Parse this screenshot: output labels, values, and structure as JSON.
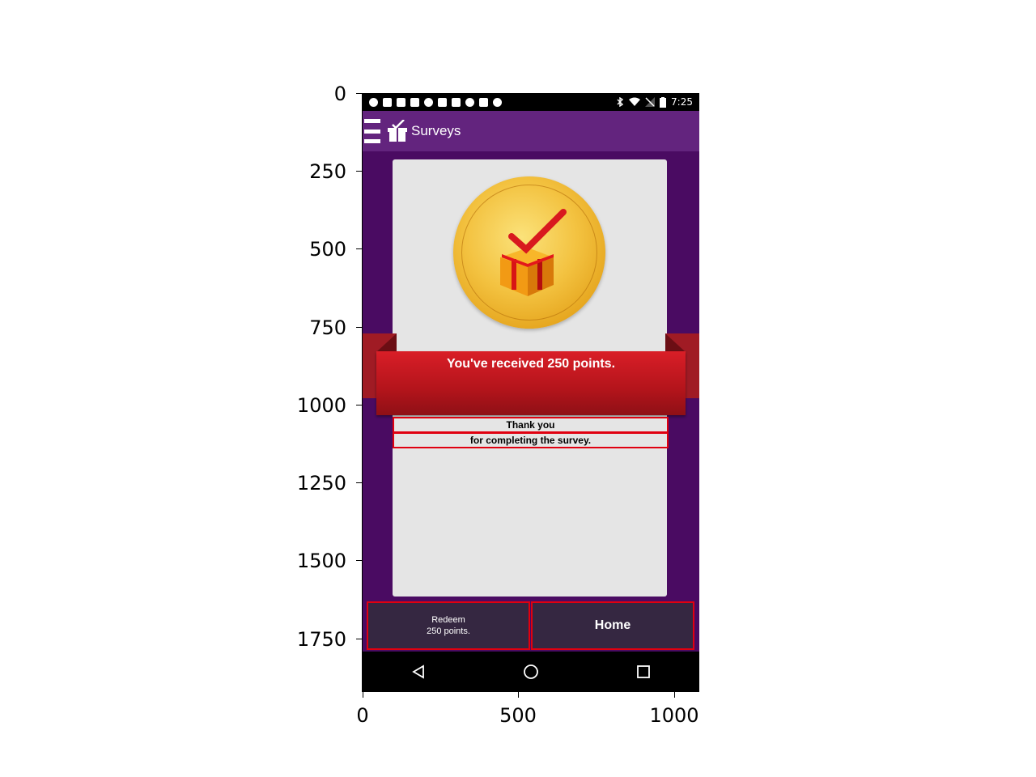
{
  "axes": {
    "y_ticks": [
      "0",
      "250",
      "500",
      "750",
      "1000",
      "1250",
      "1500",
      "1750"
    ],
    "x_ticks": [
      "0",
      "500",
      "1000"
    ]
  },
  "status_bar": {
    "time": "7:25",
    "icons_left": [
      "record-icon",
      "facebook-icon",
      "facebook-icon",
      "facebook-icon",
      "swirl-icon",
      "facebook-icon",
      "tools-icon",
      "info-icon",
      "lock-icon",
      "android-icon"
    ],
    "icons_right": [
      "bluetooth-icon",
      "wifi-icon",
      "no-signal-icon",
      "battery-icon"
    ]
  },
  "app_bar": {
    "title": "Surveys",
    "menu_icon": "hamburger-menu-icon",
    "logo_icon": "gift-check-icon"
  },
  "reward": {
    "banner_text": "You've received 250 points.",
    "message_line1": "Thank you",
    "message_line2": "for completing the survey.",
    "coin_icon": "gold-coin-gift-icon"
  },
  "actions": {
    "redeem_line1": "Redeem",
    "redeem_line2": "250 points.",
    "home_label": "Home"
  },
  "nav_bar": {
    "back_icon": "back-triangle-icon",
    "home_icon": "home-circle-icon",
    "recents_icon": "recents-square-icon"
  },
  "colors": {
    "background": "#4a0b62",
    "app_bar": "#63247e",
    "card": "#e5e5e5",
    "ribbon": "#c8171f",
    "button": "#352741",
    "highlight_border": "#e00010"
  }
}
